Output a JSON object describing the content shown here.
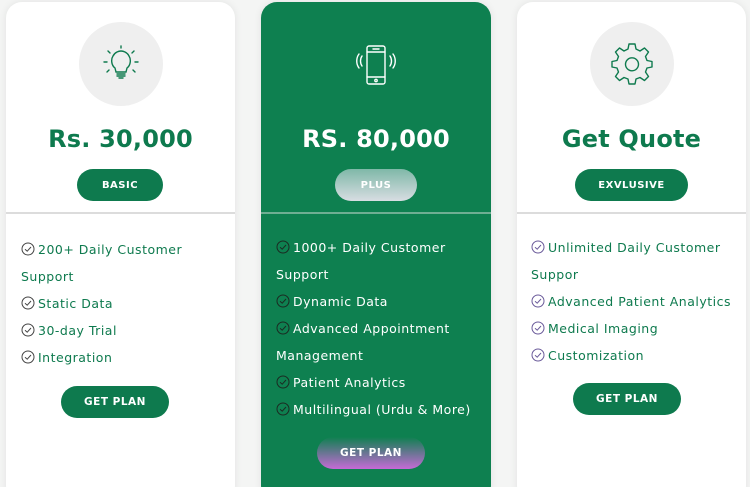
{
  "colors": {
    "brand_green": "#0e7a4e",
    "featured_bg": "#0e8050",
    "card_bg": "#ffffff"
  },
  "plans": [
    {
      "icon": "lightbulb-icon",
      "price": "Rs. 30,000",
      "tier": "BASIC",
      "features": [
        "200+ Daily Customer Support",
        "Static Data",
        "30-day Trial",
        "Integration"
      ],
      "cta": "GET PLAN"
    },
    {
      "icon": "mobile-phone-icon",
      "price": "RS. 80,000",
      "tier": "PLUS",
      "features": [
        "1000+ Daily Customer Support",
        "Dynamic Data",
        "Advanced Appointment Management",
        "Patient Analytics",
        "Multilingual (Urdu & More)"
      ],
      "cta": "GET PLAN"
    },
    {
      "icon": "gear-icon",
      "price": "Get Quote",
      "tier": "EXVLUSIVE",
      "features": [
        "Unlimited Daily Customer Suppor",
        "Advanced Patient Analytics",
        "Medical Imaging",
        "Customization"
      ],
      "cta": "GET PLAN"
    }
  ]
}
